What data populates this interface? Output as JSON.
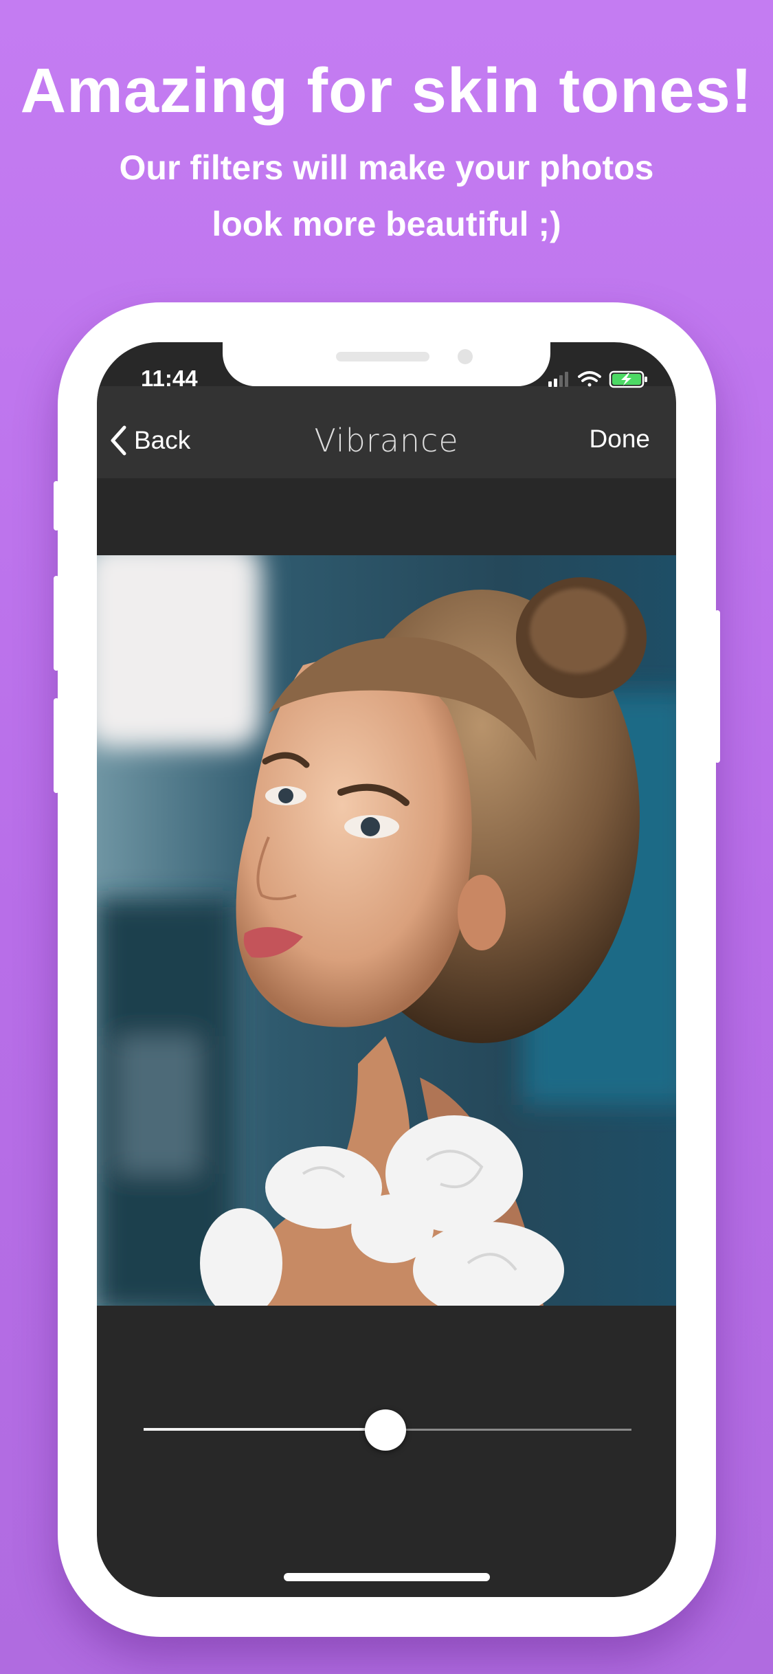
{
  "promo": {
    "headline": "Amazing for skin tones!",
    "subline1": "Our filters will make your photos",
    "subline2": "look more beautiful ;)"
  },
  "status_bar": {
    "time": "11:44",
    "icons": [
      "cellular-signal-icon",
      "wifi-icon",
      "battery-charging-icon"
    ]
  },
  "navbar": {
    "back_label": "Back",
    "title": "Vibrance",
    "done_label": "Done"
  },
  "editor": {
    "photo_subject": "portrait",
    "slider_value": 0.5
  },
  "colors": {
    "background": "#c47cf2",
    "screen": "#282828",
    "navbar": "#333333",
    "battery": "#4cd964"
  }
}
